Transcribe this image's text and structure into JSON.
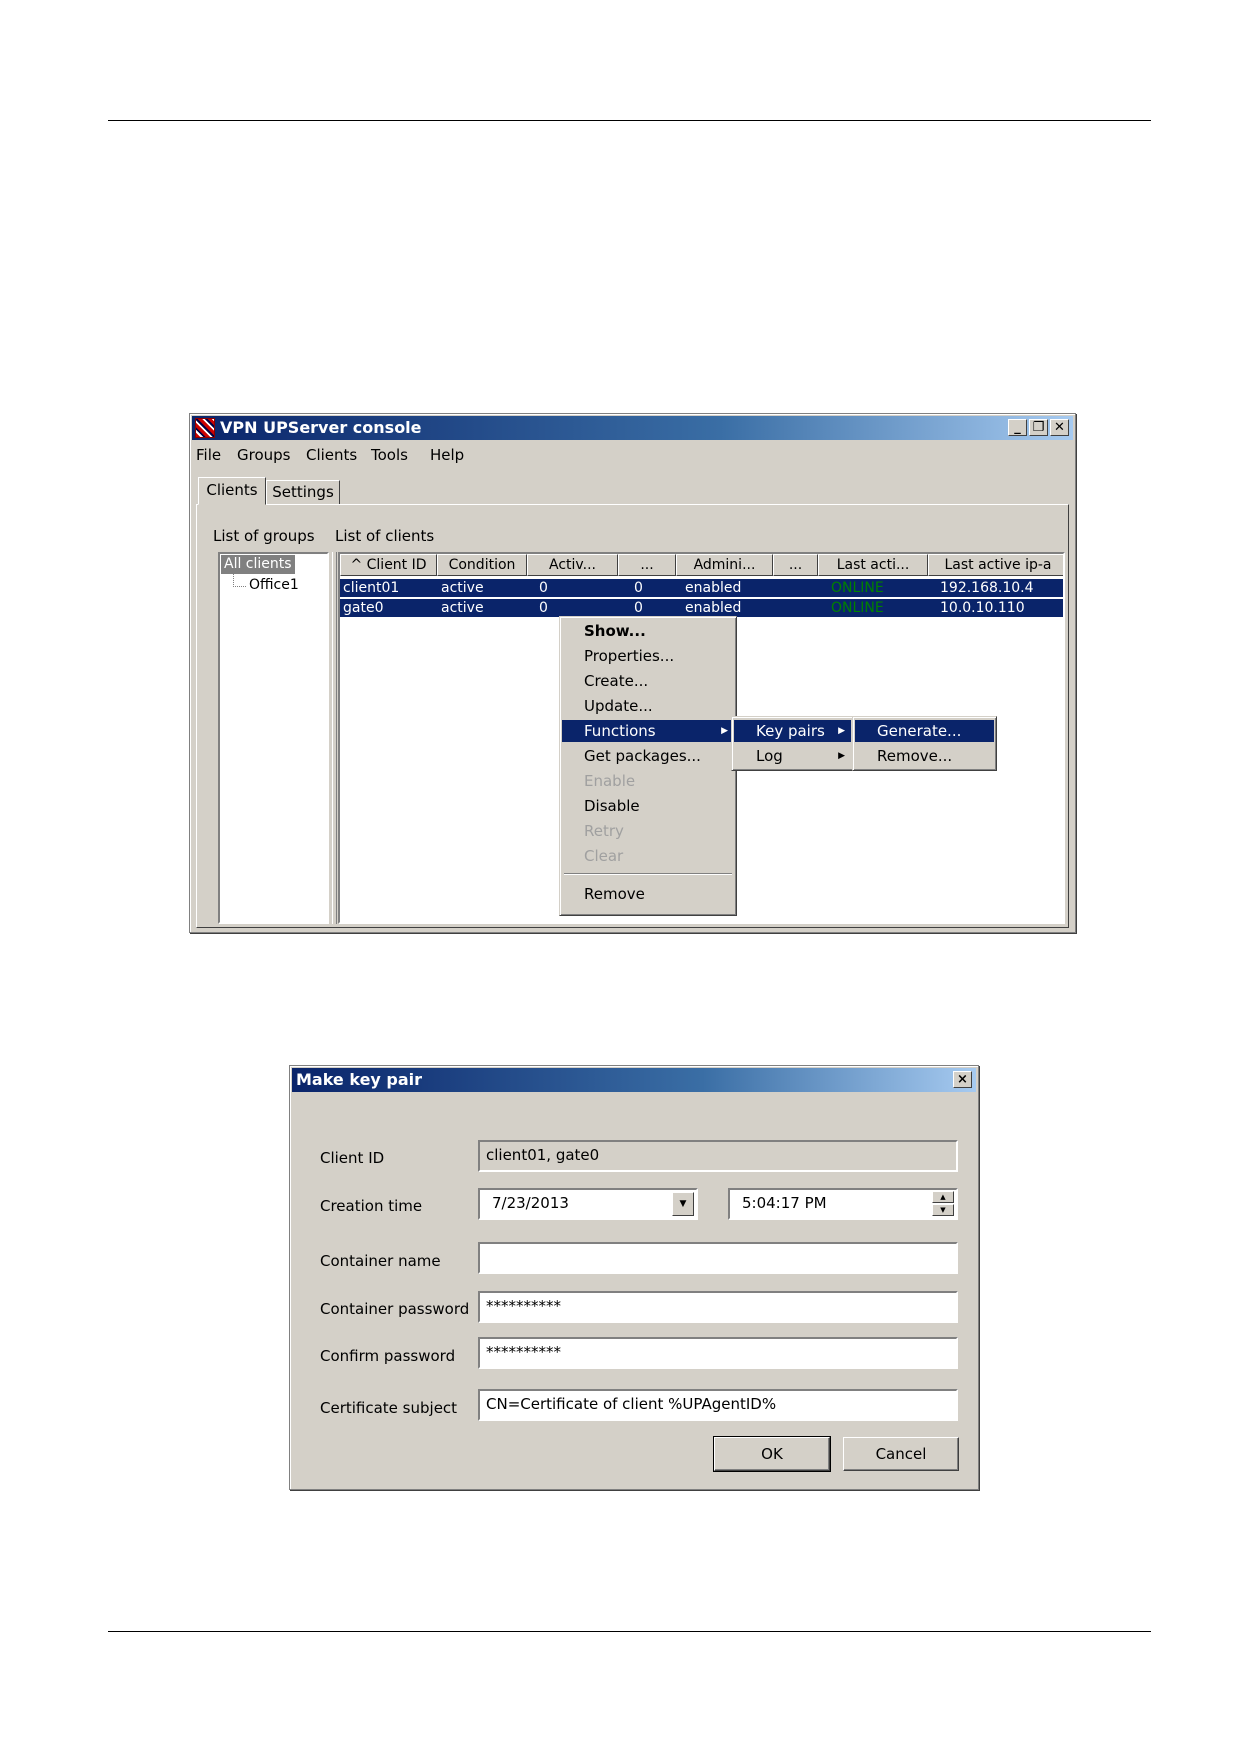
{
  "console": {
    "title": "VPN UPServer console",
    "menu": [
      "File",
      "Groups",
      "Clients",
      "Tools",
      "Help"
    ],
    "tabs": [
      "Clients",
      "Settings"
    ],
    "list_of_groups_label": "List of groups",
    "list_of_clients_label": "List of clients",
    "groups": [
      "All clients",
      "Office1"
    ],
    "columns": [
      "^ Client ID",
      "Condition",
      "Activ...",
      "...",
      "Admini...",
      "...",
      "Last acti...",
      "Last active ip-a"
    ],
    "rows": [
      [
        "client01",
        "active",
        "0",
        "0",
        "enabled",
        "",
        "ONLINE",
        "192.168.10.4"
      ],
      [
        "gate0",
        "active",
        "0",
        "0",
        "enabled",
        "",
        "ONLINE",
        "10.0.10.110"
      ]
    ],
    "context_menu": [
      "Show...",
      "Properties...",
      "Create...",
      "Update...",
      "Functions",
      "Get packages...",
      "Enable",
      "Disable",
      "Retry",
      "Clear",
      "Remove"
    ],
    "functions_submenu": [
      "Key pairs",
      "Log"
    ],
    "keypairs_submenu": [
      "Generate...",
      "Remove..."
    ]
  },
  "dialog": {
    "title": "Make key pair",
    "close": "×",
    "client_id_label": "Client ID",
    "client_id_value": "client01, gate0",
    "creation_time_label": "Creation time",
    "date_value": "7/23/2013",
    "time_value": "5:04:17 PM",
    "container_name_label": "Container name",
    "container_name_value": "",
    "container_password_label": "Container password",
    "container_password_value": "**********",
    "confirm_password_label": "Confirm password",
    "confirm_password_value": "**********",
    "certificate_subject_label": "Certificate subject",
    "certificate_subject_value": "CN=Certificate of client %UPAgentID%",
    "ok_label": "OK",
    "cancel_label": "Cancel"
  }
}
